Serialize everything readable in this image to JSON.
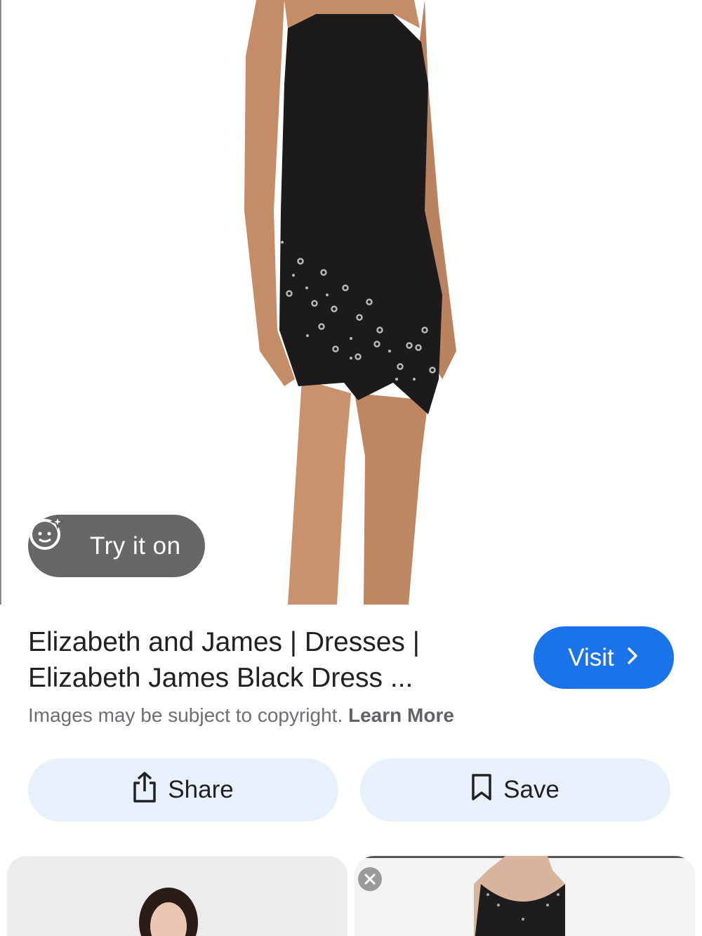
{
  "hero": {
    "try_on_label": "Try it on"
  },
  "result": {
    "title_line1": "Elizabeth and James | Dresses |",
    "title_line2": "Elizabeth James Black Dress ...",
    "visit_label": "Visit",
    "copyright_text": "Images may be subject to copyright.",
    "learn_more_label": "Learn More"
  },
  "actions": {
    "share_label": "Share",
    "save_label": "Save"
  },
  "colors": {
    "visit_button": "#1a73e8",
    "action_button_bg": "#e8f0fc",
    "try_on_pill": "#5f5f5f"
  },
  "icons": {
    "try_on": "sparkle-face-icon",
    "visit": "chevron-right-icon",
    "share": "share-icon",
    "save": "bookmark-icon",
    "thumb_close": "close-icon"
  }
}
